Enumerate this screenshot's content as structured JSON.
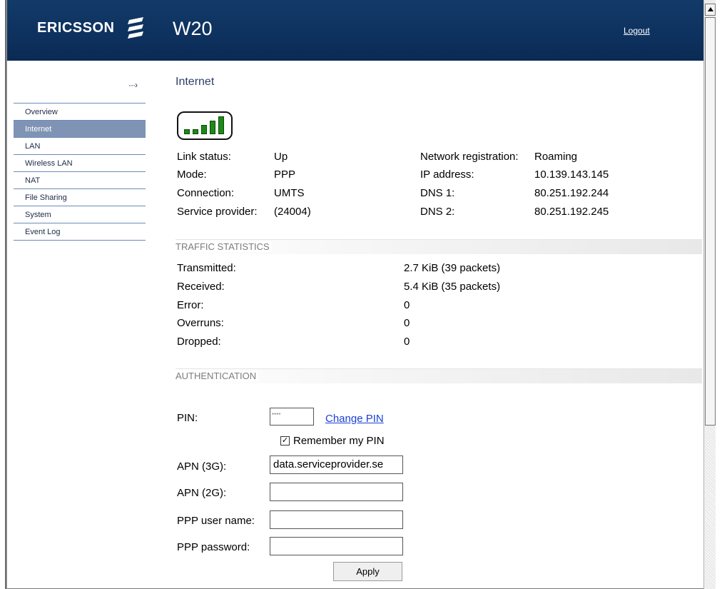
{
  "header": {
    "logo_text": "ERICSSON",
    "product": "W20",
    "logout_label": "Logout"
  },
  "sidebar": {
    "items": [
      {
        "label": "Overview"
      },
      {
        "label": "Internet"
      },
      {
        "label": "LAN"
      },
      {
        "label": "Wireless LAN"
      },
      {
        "label": "NAT"
      },
      {
        "label": "File Sharing"
      },
      {
        "label": "System"
      },
      {
        "label": "Event Log"
      }
    ]
  },
  "page": {
    "title": "Internet",
    "signal_bars": 5
  },
  "status": {
    "link_status_label": "Link status:",
    "link_status": "Up",
    "mode_label": "Mode:",
    "mode": "PPP",
    "connection_label": "Connection:",
    "connection": "UMTS",
    "provider_label": "Service provider:",
    "provider": "(24004)",
    "network_reg_label": "Network registration:",
    "network_reg": "Roaming",
    "ip_label": "IP address:",
    "ip": "10.139.143.145",
    "dns1_label": "DNS 1:",
    "dns1": "80.251.192.244",
    "dns2_label": "DNS 2:",
    "dns2": "80.251.192.245"
  },
  "traffic": {
    "heading": "TRAFFIC STATISTICS",
    "rows": [
      {
        "label": "Transmitted:",
        "value": "2.7 KiB (39 packets)"
      },
      {
        "label": "Received:",
        "value": "5.4 KiB (35 packets)"
      },
      {
        "label": "Error:",
        "value": "0"
      },
      {
        "label": "Overruns:",
        "value": "0"
      },
      {
        "label": "Dropped:",
        "value": "0"
      }
    ]
  },
  "auth": {
    "heading": "AUTHENTICATION",
    "pin_label": "PIN:",
    "pin_value": "****",
    "change_pin": "Change PIN",
    "remember_pin": "Remember my PIN",
    "remember_checked": true,
    "apn3g_label": "APN (3G):",
    "apn3g_value": "data.serviceprovider.se",
    "apn2g_label": "APN (2G):",
    "apn2g_value": "",
    "ppp_user_label": "PPP user name:",
    "ppp_user_value": "",
    "ppp_pass_label": "PPP password:",
    "ppp_pass_value": "",
    "apply_label": "Apply"
  },
  "colors": {
    "header_bg": "#0e3260",
    "active_nav": "#7f94b4",
    "signal_green": "#1d8a15",
    "link": "#1a3fd6"
  }
}
